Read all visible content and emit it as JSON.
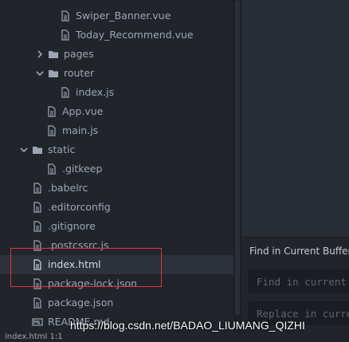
{
  "tree": {
    "items": [
      {
        "label": "",
        "kind": "file"
      },
      {
        "label": "Swiper_Banner.vue",
        "kind": "file"
      },
      {
        "label": "Today_Recommend.vue",
        "kind": "file"
      },
      {
        "label": "pages",
        "kind": "folder",
        "expanded": false
      },
      {
        "label": "router",
        "kind": "folder",
        "expanded": true
      },
      {
        "label": "index.js",
        "kind": "file"
      },
      {
        "label": "App.vue",
        "kind": "file"
      },
      {
        "label": "main.js",
        "kind": "file"
      },
      {
        "label": "static",
        "kind": "folder",
        "expanded": true
      },
      {
        "label": ".gitkeep",
        "kind": "file"
      },
      {
        "label": ".babelrc",
        "kind": "file"
      },
      {
        "label": ".editorconfig",
        "kind": "file"
      },
      {
        "label": ".gitignore",
        "kind": "file"
      },
      {
        "label": ".postcssrc.js",
        "kind": "file"
      },
      {
        "label": "index.html",
        "kind": "file",
        "selected": true
      },
      {
        "label": "package-lock.json",
        "kind": "file"
      },
      {
        "label": "package.json",
        "kind": "file"
      },
      {
        "label": "README.md",
        "kind": "markdown"
      }
    ]
  },
  "find_panel": {
    "title": "Find in Current Buffer",
    "find_placeholder": "Find in current buffer",
    "replace_placeholder": "Replace in current buffer"
  },
  "status_bar": {
    "text": "index.html   1:1"
  },
  "watermark": "https://blog.csdn.net/BADAO_LIUMANG_QIZHI",
  "colors": {
    "background": "#21252b",
    "selection": "#2c313a",
    "text": "#9da5b4",
    "highlight_box": "#e0343a"
  }
}
